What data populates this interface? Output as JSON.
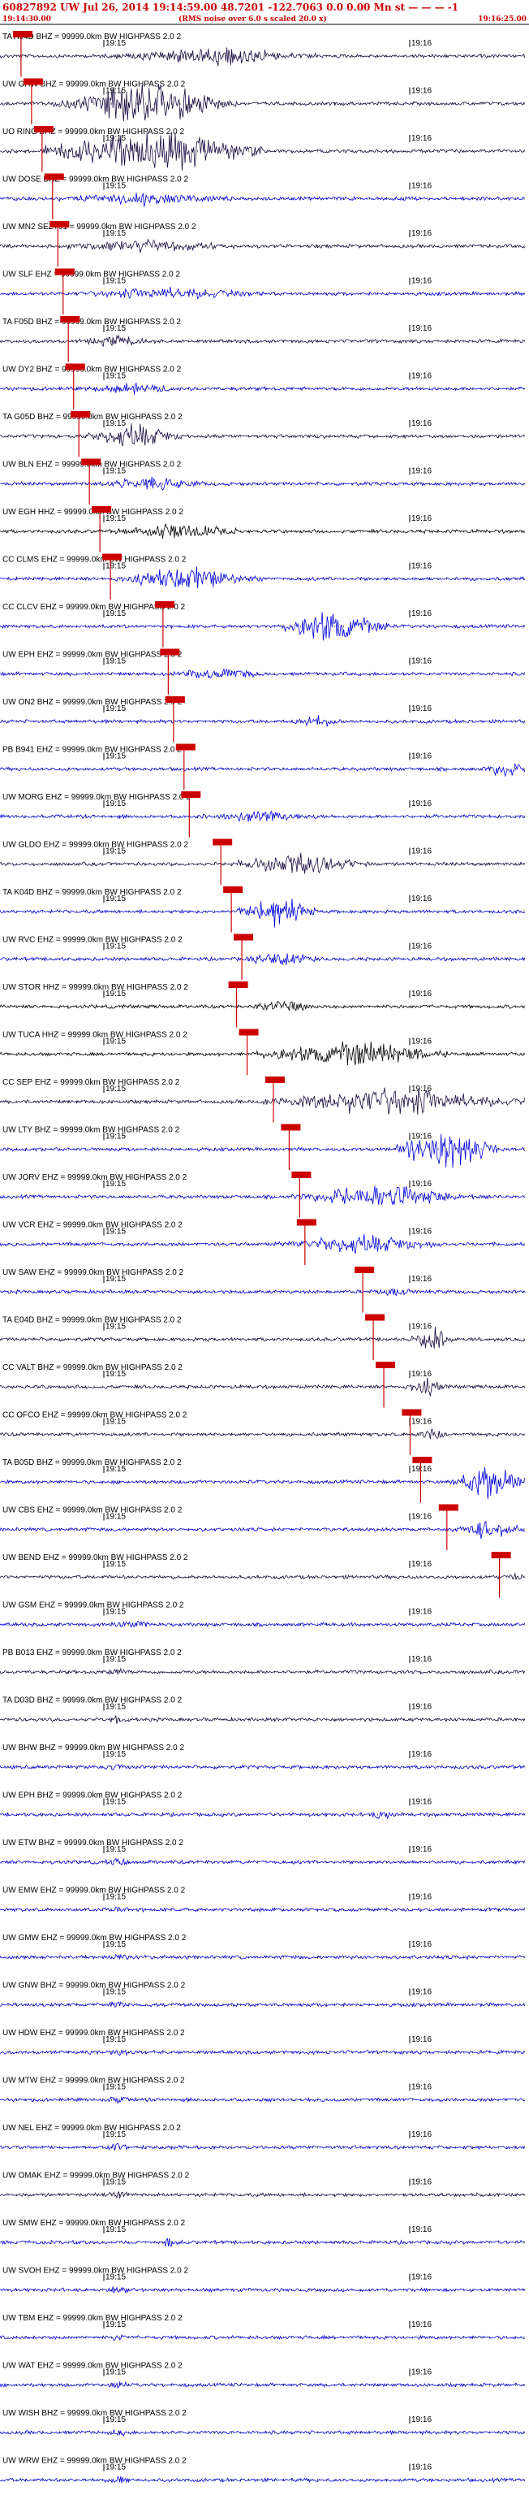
{
  "header": {
    "title": "60827892 UW Jul 26, 2014 19:14:59.00   48.7201 -122.7063  0.0 0.00 Mn st — — — -1",
    "start_time": "19:14:30.00",
    "subtitle": "(RMS noise over 6.0 s scaled 20.0 x)",
    "end_time": "19:16:25.00"
  },
  "colors": {
    "header_red": "#cc0000",
    "pick_red": "#cc0000",
    "trace_blue": "#0000e0",
    "trace_dark": "#1a0a40",
    "trace_black": "#000000"
  },
  "chart_data": {
    "type": "line",
    "title": "60827892 UW Jul 26, 2014 19:14:59.00   48.7201 -122.7063  0.0 0.00 Mn st — — — -1",
    "x_range": [
      "19:14:30.00",
      "19:16:25.00"
    ],
    "tick_labels": [
      "19:15",
      "19:16"
    ],
    "grid": false,
    "channel_suffix": " = 99999.0km BW  HIGHPASS  2.0  2",
    "channels": [
      {
        "name": "TA A04D BHZ",
        "color": "dark",
        "pick": 0.04,
        "event": [
          0.22,
          0.6,
          3
        ]
      },
      {
        "name": "UW GHW BHZ",
        "color": "dark",
        "pick": 0.06,
        "event": [
          0.1,
          0.45,
          8
        ]
      },
      {
        "name": "UO RING BHZ",
        "color": "dark",
        "pick": 0.08,
        "event": [
          0.08,
          0.5,
          10
        ]
      },
      {
        "name": "UW DOSE BHZ",
        "color": "blue",
        "pick": 0.1,
        "event": [
          0.11,
          0.45,
          2
        ]
      },
      {
        "name": "UW MN2 SEZT01",
        "color": "dark",
        "pick": 0.11,
        "event": [
          0.12,
          0.45,
          2
        ]
      },
      {
        "name": "UW SLF EHZ",
        "color": "blue",
        "pick": 0.12,
        "event": [
          0.14,
          0.5,
          2
        ]
      },
      {
        "name": "TA F05D BHZ",
        "color": "dark",
        "pick": 0.13,
        "event": [
          0.15,
          0.3,
          1.5
        ]
      },
      {
        "name": "UW DY2 BHZ",
        "color": "blue",
        "pick": 0.14,
        "event": [
          0.16,
          0.35,
          1.5
        ]
      },
      {
        "name": "TA G05D BHZ",
        "color": "dark",
        "pick": 0.15,
        "event": [
          0.16,
          0.35,
          4
        ]
      },
      {
        "name": "UW BLN EHZ",
        "color": "blue",
        "pick": 0.17,
        "event": [
          0.18,
          0.4,
          2
        ]
      },
      {
        "name": "UW EGH HHZ",
        "color": "black",
        "pick": 0.19,
        "event": [
          0.22,
          0.45,
          3
        ]
      },
      {
        "name": "CC CLMS EHZ",
        "color": "blue",
        "pick": 0.21,
        "event": [
          0.22,
          0.5,
          4
        ]
      },
      {
        "name": "CC CLCV EHZ",
        "color": "blue",
        "pick": 0.31,
        "event": [
          0.53,
          0.74,
          7
        ]
      },
      {
        "name": "UW EPH EHZ",
        "color": "blue",
        "pick": 0.32,
        "event": [
          0.33,
          0.5,
          2
        ]
      },
      {
        "name": "UW ON2 BHZ",
        "color": "blue",
        "pick": 0.33,
        "event": [
          0.55,
          0.65,
          2
        ]
      },
      {
        "name": "PB B941 EHZ",
        "color": "blue",
        "pick": 0.35,
        "event": [
          0.92,
          1.0,
          3
        ]
      },
      {
        "name": "UW MORG EHZ",
        "color": "blue",
        "pick": 0.36,
        "event": [
          0.38,
          0.6,
          2
        ]
      },
      {
        "name": "UW GLDO EHZ",
        "color": "dark",
        "pick": 0.42,
        "event": [
          0.44,
          0.7,
          4
        ]
      },
      {
        "name": "TA K04D BHZ",
        "color": "blue",
        "pick": 0.44,
        "event": [
          0.45,
          0.6,
          6
        ]
      },
      {
        "name": "UW RVC EHZ",
        "color": "blue",
        "pick": 0.46,
        "event": [
          0.47,
          0.6,
          3
        ]
      },
      {
        "name": "UW STOR HHZ",
        "color": "black",
        "pick": 0.45,
        "event": [
          0.47,
          0.6,
          2
        ]
      },
      {
        "name": "UW TUCA HHZ",
        "color": "black",
        "pick": 0.47,
        "event": [
          0.48,
          0.85,
          5
        ]
      },
      {
        "name": "CC SEP EHZ",
        "color": "dark",
        "pick": 0.52,
        "event": [
          0.5,
          1.0,
          5
        ]
      },
      {
        "name": "UW LTY BHZ",
        "color": "blue",
        "pick": 0.55,
        "event": [
          0.75,
          0.95,
          9
        ]
      },
      {
        "name": "UW JORV EHZ",
        "color": "blue",
        "pick": 0.57,
        "event": [
          0.55,
          0.9,
          4
        ]
      },
      {
        "name": "UW VCR EHZ",
        "color": "blue",
        "pick": 0.58,
        "event": [
          0.52,
          0.85,
          3
        ]
      },
      {
        "name": "UW SAW EHZ",
        "color": "blue",
        "pick": 0.69,
        "event": [
          0.7,
          0.8,
          1
        ]
      },
      {
        "name": "TA E04D BHZ",
        "color": "dark",
        "pick": 0.71,
        "event": [
          0.78,
          0.86,
          5
        ]
      },
      {
        "name": "CC VALT BHZ",
        "color": "dark",
        "pick": 0.73,
        "event": [
          0.77,
          0.85,
          3
        ]
      },
      {
        "name": "CC OFCO EHZ",
        "color": "dark",
        "pick": 0.78,
        "event": [
          0.79,
          0.85,
          2
        ]
      },
      {
        "name": "TA B05D BHZ",
        "color": "blue",
        "pick": 0.8,
        "event": [
          0.86,
          1.0,
          7
        ]
      },
      {
        "name": "UW CBS EHZ",
        "color": "blue",
        "pick": 0.85,
        "event": [
          0.86,
          1.0,
          3
        ]
      },
      {
        "name": "UW BEND EHZ",
        "color": "dark",
        "pick": 0.95,
        "event": [
          0.96,
          1.0,
          1
        ]
      },
      {
        "name": "UW GSM EHZ",
        "color": "blue",
        "pick": null,
        "event": [
          0.2,
          0.3,
          1
        ]
      },
      {
        "name": "PB B013 EHZ",
        "color": "dark",
        "pick": null,
        "event": [
          0.2,
          0.25,
          1
        ]
      },
      {
        "name": "TA D03D BHZ",
        "color": "dark",
        "pick": null,
        "event": [
          0.2,
          0.25,
          1
        ]
      },
      {
        "name": "UW BHW BHZ",
        "color": "blue",
        "pick": null,
        "event": [
          0.2,
          0.25,
          1
        ]
      },
      {
        "name": "UW EPH BHZ",
        "color": "blue",
        "pick": null,
        "event": [
          0.7,
          0.75,
          2
        ]
      },
      {
        "name": "UW ETW BHZ",
        "color": "blue",
        "pick": null,
        "event": [
          0.2,
          0.25,
          1
        ]
      },
      {
        "name": "UW EMW EHZ",
        "color": "blue",
        "pick": null,
        "event": [
          0.2,
          0.25,
          1
        ]
      },
      {
        "name": "UW GMW EHZ",
        "color": "blue",
        "pick": null,
        "event": [
          0.2,
          0.25,
          1
        ]
      },
      {
        "name": "UW GNW BHZ",
        "color": "blue",
        "pick": null,
        "event": [
          0.2,
          0.25,
          1
        ]
      },
      {
        "name": "UW HDW EHZ",
        "color": "blue",
        "pick": null,
        "event": [
          0.2,
          0.25,
          1
        ]
      },
      {
        "name": "UW MTW EHZ",
        "color": "blue",
        "pick": null,
        "event": [
          0.2,
          0.25,
          1
        ]
      },
      {
        "name": "UW NEL EHZ",
        "color": "blue",
        "pick": null,
        "event": [
          0.2,
          0.25,
          1
        ]
      },
      {
        "name": "UW OMAK EHZ",
        "color": "dark",
        "pick": null,
        "event": [
          0.2,
          0.25,
          1
        ]
      },
      {
        "name": "UW SMW EHZ",
        "color": "blue",
        "pick": null,
        "event": [
          0.3,
          0.35,
          1.5
        ]
      },
      {
        "name": "UW SVOH EHZ",
        "color": "blue",
        "pick": null,
        "event": [
          0.2,
          0.25,
          1
        ]
      },
      {
        "name": "UW TBM EHZ",
        "color": "blue",
        "pick": null,
        "event": [
          0.2,
          0.25,
          1
        ]
      },
      {
        "name": "UW WAT EHZ",
        "color": "blue",
        "pick": null,
        "event": [
          0.2,
          0.25,
          1
        ]
      },
      {
        "name": "UW WISH BHZ",
        "color": "blue",
        "pick": null,
        "event": [
          0.2,
          0.25,
          1
        ]
      },
      {
        "name": "UW WRW EHZ",
        "color": "blue",
        "pick": null,
        "event": [
          0.2,
          0.25,
          1
        ]
      }
    ]
  }
}
